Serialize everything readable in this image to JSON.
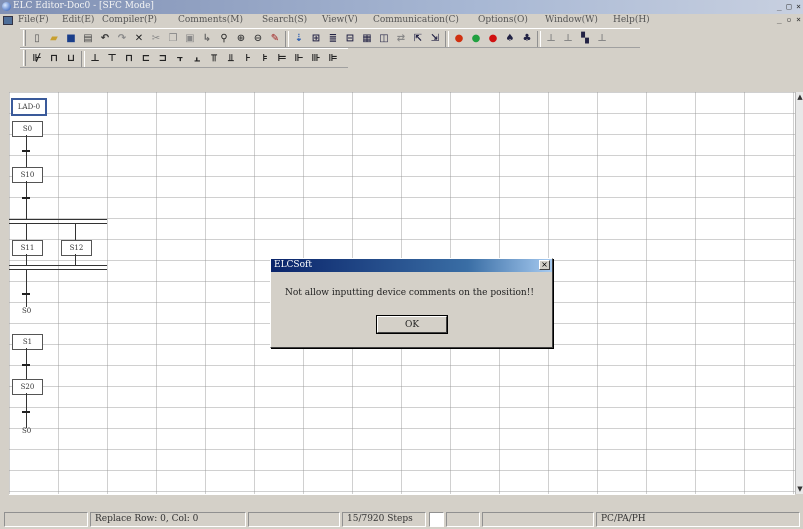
{
  "window": {
    "title": "ELC Editor-Doc0 - [SFC Mode]",
    "controls": "_ □ ×",
    "mdi_controls": "_ ▫ ×"
  },
  "menu": [
    "File(F)",
    "Edit(E)",
    "Compiler(P)",
    "Comments(M)",
    "Search(S)",
    "View(V)",
    "Communication(C)",
    "Options(O)",
    "Window(W)",
    "Help(H)"
  ],
  "toolbar1": {
    "icons": [
      {
        "name": "new-file-icon",
        "glyph": "▯",
        "color": "#555"
      },
      {
        "name": "open-folder-icon",
        "glyph": "▰",
        "color": "#c8a030"
      },
      {
        "name": "save-icon",
        "glyph": "■",
        "color": "#1a3e8a"
      },
      {
        "name": "print-icon",
        "glyph": "▤",
        "color": "#444"
      },
      {
        "name": "undo-icon",
        "glyph": "↶",
        "color": "#333"
      },
      {
        "name": "redo-icon",
        "glyph": "↷",
        "color": "#888"
      },
      {
        "name": "delete-icon",
        "glyph": "✕",
        "color": "#222"
      },
      {
        "name": "cut-icon",
        "glyph": "✂",
        "color": "#888"
      },
      {
        "name": "copy-icon",
        "glyph": "❐",
        "color": "#888"
      },
      {
        "name": "paste-icon",
        "glyph": "▣",
        "color": "#888"
      },
      {
        "name": "insert-icon",
        "glyph": "↳",
        "color": "#666"
      },
      {
        "name": "find-icon",
        "glyph": "⚲",
        "color": "#222"
      },
      {
        "name": "zoom-in-icon",
        "glyph": "⊕",
        "color": "#444"
      },
      {
        "name": "zoom-out-icon",
        "glyph": "⊖",
        "color": "#444"
      },
      {
        "name": "comment-edit-icon",
        "glyph": "✎",
        "color": "#a02020"
      },
      {
        "name": "compile-icon",
        "glyph": "⇣",
        "color": "#3060b0"
      },
      {
        "name": "ladder-icon",
        "glyph": "⊞",
        "color": "#224"
      },
      {
        "name": "il-icon",
        "glyph": "≣",
        "color": "#224"
      },
      {
        "name": "sfc-icon",
        "glyph": "⊟",
        "color": "#224"
      },
      {
        "name": "monitor-icon",
        "glyph": "▦",
        "color": "#224"
      },
      {
        "name": "window-icon",
        "glyph": "◫",
        "color": "#224"
      },
      {
        "name": "transfer-icon",
        "glyph": "⇄",
        "color": "#888"
      },
      {
        "name": "upload-icon",
        "glyph": "⇱",
        "color": "#224"
      },
      {
        "name": "download-icon",
        "glyph": "⇲",
        "color": "#224"
      },
      {
        "name": "run-icon",
        "glyph": "●",
        "color": "#d03010"
      },
      {
        "name": "status-icon",
        "glyph": "●",
        "color": "#20a040"
      },
      {
        "name": "stop-icon",
        "glyph": "●",
        "color": "#d01010"
      },
      {
        "name": "device-monitor-icon",
        "glyph": "♠",
        "color": "#224"
      },
      {
        "name": "register-monitor-icon",
        "glyph": "♣",
        "color": "#224"
      },
      {
        "name": "set-on-icon",
        "glyph": "⊥",
        "color": "#888"
      },
      {
        "name": "set-off-icon",
        "glyph": "⊥",
        "color": "#888"
      },
      {
        "name": "bit-monitor-icon",
        "glyph": "▚",
        "color": "#224"
      },
      {
        "name": "word-monitor-icon",
        "glyph": "⊥",
        "color": "#888"
      }
    ]
  },
  "toolbar2": {
    "icons": [
      {
        "name": "sfc-ladder-icon",
        "glyph": "⊮",
        "color": "#222"
      },
      {
        "name": "sfc-step-icon",
        "glyph": "⊓",
        "color": "#222"
      },
      {
        "name": "sfc-jump-icon",
        "glyph": "⊔",
        "color": "#222"
      },
      {
        "name": "sfc-transition-icon",
        "glyph": "⊥",
        "color": "#222"
      },
      {
        "name": "sfc-divergence-icon",
        "glyph": "⊤",
        "color": "#222"
      },
      {
        "name": "sfc-convergence-icon",
        "glyph": "⊓",
        "color": "#222"
      },
      {
        "name": "sfc-branch-a-icon",
        "glyph": "⊏",
        "color": "#222"
      },
      {
        "name": "sfc-branch-b-icon",
        "glyph": "⊐",
        "color": "#222"
      },
      {
        "name": "sfc-branch-c-icon",
        "glyph": "⫟",
        "color": "#222"
      },
      {
        "name": "sfc-branch-d-icon",
        "glyph": "⫠",
        "color": "#222"
      },
      {
        "name": "sfc-parallel-a-icon",
        "glyph": "⫪",
        "color": "#222"
      },
      {
        "name": "sfc-parallel-b-icon",
        "glyph": "⫫",
        "color": "#222"
      },
      {
        "name": "sfc-parallel-c-icon",
        "glyph": "⊦",
        "color": "#222"
      },
      {
        "name": "sfc-parallel-d-icon",
        "glyph": "⊧",
        "color": "#222"
      },
      {
        "name": "sfc-parallel-e-icon",
        "glyph": "⊨",
        "color": "#222"
      },
      {
        "name": "sfc-parallel-f-icon",
        "glyph": "⊩",
        "color": "#222"
      },
      {
        "name": "sfc-parallel-g-icon",
        "glyph": "⊪",
        "color": "#222"
      },
      {
        "name": "sfc-parallel-h-icon",
        "glyph": "⊫",
        "color": "#222"
      }
    ]
  },
  "sfc": {
    "initial_step": "LAD-0",
    "steps": {
      "s0": "S0",
      "s10": "S10",
      "s11": "S11",
      "s12": "S12",
      "s1": "S1",
      "s20": "S20"
    },
    "jumps": {
      "j1": "S0",
      "j2": "S0"
    }
  },
  "dialog": {
    "title": "ELCSoft",
    "close": "×",
    "message": "Not allow inputting device comments on the position!!",
    "ok_label": "OK"
  },
  "statusbar": {
    "mode": "Replace",
    "position": "Row: 0, Col: 0",
    "steps": "15/7920 Steps",
    "model": "PC/PA/PH"
  },
  "colors": {
    "title_gradient_start": "#0a246a",
    "title_gradient_end": "#a6caf0",
    "face": "#d4d0c8"
  }
}
